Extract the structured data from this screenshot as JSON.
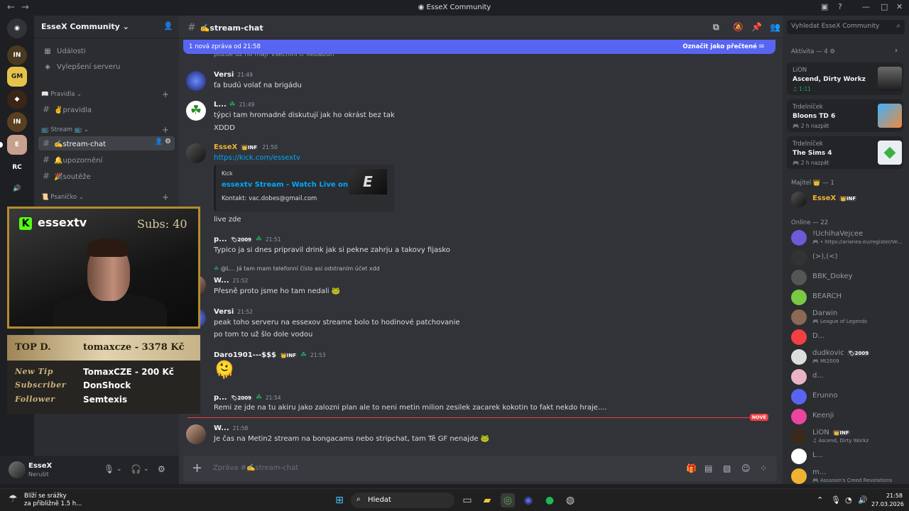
{
  "window": {
    "title": "EsseX Community",
    "back": "←",
    "forward": "→"
  },
  "server": {
    "name": "EsseX Community"
  },
  "nav": [
    {
      "label": "Události",
      "icon": "calendar-icon"
    },
    {
      "label": "Vylepšení serveru",
      "icon": "boost-icon"
    }
  ],
  "categories": {
    "pravidla": "Pravidla",
    "stream": "Stream",
    "psanicko": "Psaníčko"
  },
  "channels": [
    {
      "name": "✌️pravidla"
    },
    {
      "name": "✍️stream-chat"
    },
    {
      "name": "🔔upozornění"
    },
    {
      "name": "🎉soutěže"
    }
  ],
  "overlay": {
    "channel": "essextv",
    "subs": "Subs: 40",
    "top_label": "TOP D.",
    "top_value": "tomaxcze - 3378 Kč",
    "rows": [
      {
        "k": "New Tip",
        "v": "TomaxCZE - 200 Kč"
      },
      {
        "k": "Subscriber",
        "v": "DonShock"
      },
      {
        "k": "Follower",
        "v": "Semtexis"
      }
    ]
  },
  "user": {
    "name": "EsseX",
    "status": "Nerušit"
  },
  "chat": {
    "channel": "✍️stream-chat",
    "new_bar": "1 nová zpráva od 21:58",
    "mark_read": "Označit jako přečtené",
    "composer_placeholder": "Zpráva #✍️stream-chat",
    "new_label": "NOVÉ",
    "partial": "pozde  uz no majr vsecnini tr kebabun",
    "messages": [
      {
        "author": "Versi",
        "time": "21:49",
        "lines": [
          "ťa budú volať na brigádu"
        ]
      },
      {
        "author": "L...",
        "time": "21:49",
        "lines": [
          "týpci tam hromadně diskutují jak ho okrást bez tak",
          "XDDD"
        ]
      },
      {
        "author": "EsseX",
        "badge": "👑INF",
        "time": "21:50",
        "lines": [
          "https://kick.com/essextv"
        ]
      },
      {
        "author": "p...",
        "badge": "🏷2009",
        "time": "21:51",
        "lines": [
          "Typico ja si dnes pripravil drink jak si pekne zahrju a takovy fijasko"
        ]
      },
      {
        "author": "W...",
        "time": "21:52",
        "lines": [
          "Přesně proto jsme ho tam nedali 🐸"
        ],
        "reply": "@L... Já tam mam telefonní číslo asi odstraním účet xdd"
      },
      {
        "author": "Versi",
        "time": "21:52",
        "lines": [
          "peak toho serveru na essexov streame bolo to hodinové patchovanie",
          "po tom to už šlo dole vodou"
        ]
      },
      {
        "author": "Daro1901---$$$",
        "badge": "👑INF",
        "time": "21:53",
        "lines": [
          "🫠"
        ]
      },
      {
        "author": "p...",
        "badge": "🏷2009",
        "time": "21:54",
        "lines": [
          "Remi ze jde na tu akiru jako zalozni plan ale to neni metin milion zesilek zacarek kokotin to fakt nekdo hraje...."
        ]
      },
      {
        "author": "W...",
        "time": "21:58",
        "lines": [
          "Je čas na Metin2 stream na bongacams nebo stripchat, tam Tě GF nenajde 🐸"
        ]
      }
    ],
    "embed": {
      "provider": "Kick",
      "title": "essextv Stream - Watch Live on Kick",
      "desc": "Kontakt: vac.dobes@gmail.com",
      "thumb": "E",
      "after": "live zde"
    }
  },
  "members": {
    "search_placeholder": "Vyhledat EsseX Community",
    "activity_header": "Aktivita — 4",
    "activities": [
      {
        "name": "LiON",
        "game": "Ascend, Dirty Workz",
        "time": "♫ 1:11"
      },
      {
        "name": "Trdelníček",
        "game": "Bloons TD 6",
        "time": "🎮 2 h nazpět"
      },
      {
        "name": "Trdelníček",
        "game": "The Sims 4",
        "time": "🎮 2 h nazpět"
      }
    ],
    "owner_header": "Majitel 👑 — 1",
    "owner": {
      "name": "EsseX",
      "badge": "👑INF"
    },
    "online_header": "Online — 22",
    "online": [
      {
        "name": "!UchihaVejcee",
        "sub": "🎮 • https://arianea.eu/register/Ve..."
      },
      {
        "name": "(>),(<)"
      },
      {
        "name": "BBK_Dokey"
      },
      {
        "name": "BEARCH"
      },
      {
        "name": "Darwin",
        "sub": "🎮 League of Legends"
      },
      {
        "name": "D..."
      },
      {
        "name": "dudkovic",
        "badge": "🏷2009",
        "sub": "🎮 Mt2009"
      },
      {
        "name": "d..."
      },
      {
        "name": "Erunno"
      },
      {
        "name": "Keenji"
      },
      {
        "name": "LiON",
        "badge": "👑INF",
        "sub": "♫ Ascend, Dirty Workz"
      },
      {
        "name": "L..."
      },
      {
        "name": "m...",
        "sub": "🎮 Assassin's Creed Revelations"
      }
    ]
  },
  "taskbar": {
    "weather1": "Blíží se srážky",
    "weather2": "za přibližně 1.5 h...",
    "search": "Hledat",
    "time": "21:58",
    "date": "27.03.2026"
  }
}
